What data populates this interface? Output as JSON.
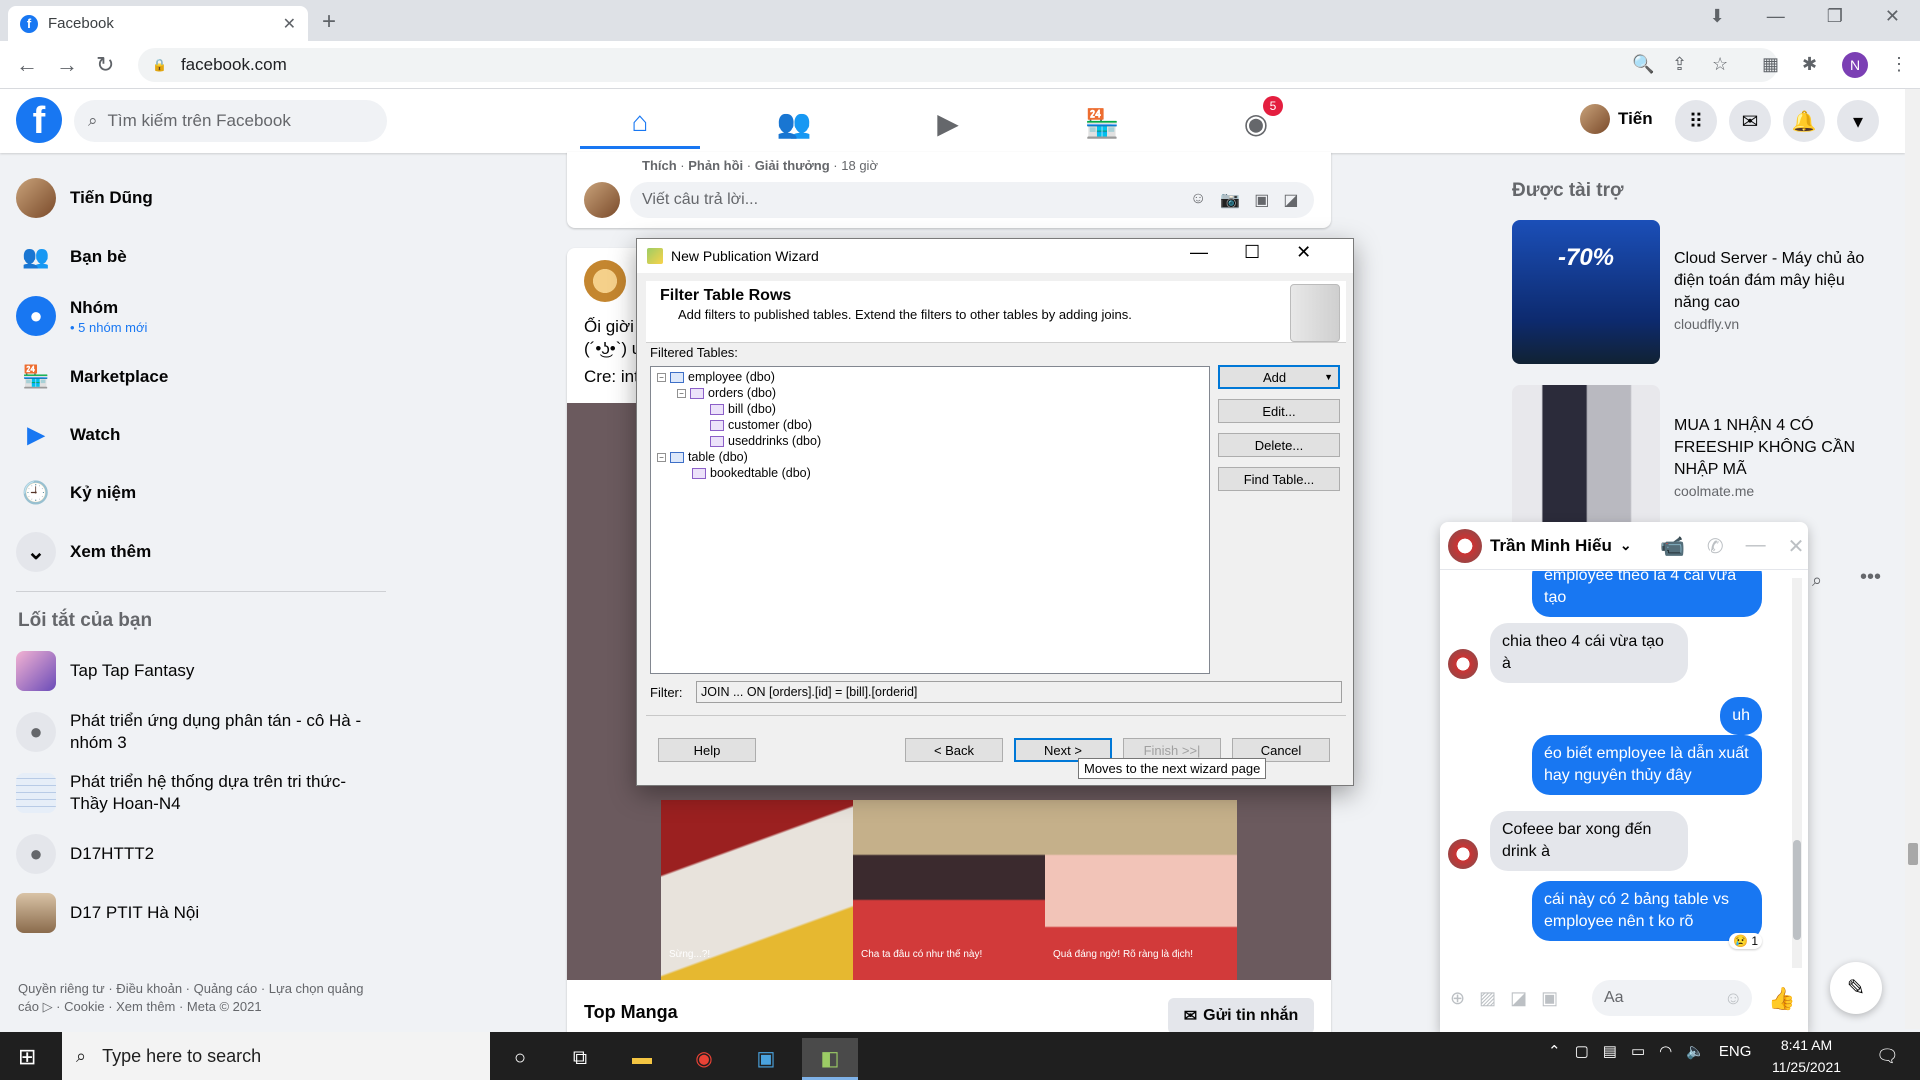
{
  "browser": {
    "tab_title": "Facebook",
    "tab_close": "✕",
    "new_tab": "+",
    "url": "facebook.com",
    "profile_initial": "N"
  },
  "fb": {
    "search_placeholder": "Tìm kiếm trên Facebook",
    "notification_count": "5",
    "user_name": "Tiến"
  },
  "sidebar": {
    "items": [
      {
        "label": "Tiến Dũng"
      },
      {
        "label": "Bạn bè"
      },
      {
        "label": "Nhóm",
        "sub": "5 nhóm mới"
      },
      {
        "label": "Marketplace"
      },
      {
        "label": "Watch"
      },
      {
        "label": "Kỷ niệm"
      },
      {
        "label": "Xem thêm"
      }
    ],
    "shortcuts_title": "Lối tắt của bạn",
    "shortcuts": [
      {
        "label": "Tap Tap Fantasy"
      },
      {
        "label": "Phát triển ứng dụng phân tán - cô Hà - nhóm 3"
      },
      {
        "label": "Phát triển hệ thống dựa trên tri thức- Thầy Hoan-N4"
      },
      {
        "label": "D17HTTT2"
      },
      {
        "label": "D17 PTIT Hà Nội"
      }
    ],
    "footer": "Quyền riêng tư · Điều khoản · Quảng cáo · Lựa chọn quảng cáo ▷ · Cookie · Xem thêm · Meta © 2021"
  },
  "feed": {
    "comment_like": "Thích",
    "comment_reply": "Phản hồi",
    "comment_award": "Giải thưởng",
    "comment_time": "18 giờ",
    "reply_placeholder": "Viết câu trả lời...",
    "post_text_1": "Ối giời",
    "post_text_2": "(´•͜ʖ•`) u",
    "post_text_3": "Cre: int",
    "captions": [
      "Sừng...?!",
      "Cha ta đâu có như thế này!",
      "Quá đáng ngờ! Rõ ràng là địch!"
    ],
    "post_title": "Top Manga",
    "send_message": "Gửi tin nhắn"
  },
  "right": {
    "sponsored": "Được tài trợ",
    "ads": [
      {
        "title": "Cloud Server - Máy chủ ảo điện toán đám mây hiệu năng cao",
        "url": "cloudfly.vn",
        "banner": "-70%"
      },
      {
        "title": "MUA 1 NHẬN 4 CÓ FREESHIP KHÔNG CẦN NHẬP MÃ",
        "url": "coolmate.me"
      }
    ]
  },
  "chat": {
    "name": "Trần Minh Hiếu",
    "messages": [
      {
        "dir": "out",
        "text": "employee theo lá 4 cái vừa tạo"
      },
      {
        "dir": "in",
        "text": "chia theo 4 cái vừa tạo à"
      },
      {
        "dir": "out",
        "text": "uh"
      },
      {
        "dir": "out",
        "text": "éo biết employee là dẫn xuất hay nguyên thủy đây"
      },
      {
        "dir": "in",
        "text": "Cofeee bar xong đến drink à"
      },
      {
        "dir": "out",
        "text": "cái này có 2 bảng table vs employee nên t ko rõ"
      }
    ],
    "reaction": "😢 1",
    "input_placeholder": "Aa"
  },
  "dialog": {
    "window_title": "New Publication Wizard",
    "header_title": "Filter Table Rows",
    "header_desc": "Add filters to published tables. Extend the filters to other tables by adding joins.",
    "filtered_tables_label": "Filtered Tables:",
    "tree": [
      {
        "label": "employee (dbo)",
        "level": 0,
        "toggle": "−"
      },
      {
        "label": "orders (dbo)",
        "level": 1,
        "toggle": "−"
      },
      {
        "label": "bill (dbo)",
        "level": 2
      },
      {
        "label": "customer (dbo)",
        "level": 2
      },
      {
        "label": "useddrinks (dbo)",
        "level": 2
      },
      {
        "label": "table (dbo)",
        "level": 0,
        "toggle": "−"
      },
      {
        "label": "bookedtable (dbo)",
        "level": 1
      }
    ],
    "buttons": {
      "add": "Add",
      "edit": "Edit...",
      "delete": "Delete...",
      "find": "Find Table...",
      "help": "Help",
      "back": "< Back",
      "next": "Next >",
      "finish": "Finish >>|",
      "cancel": "Cancel"
    },
    "filter_label": "Filter:",
    "filter_value": "JOIN ... ON [orders].[id] = [bill].[orderid]",
    "tooltip": "Moves to the next wizard page"
  },
  "taskbar": {
    "search_placeholder": "Type here to search",
    "language": "ENG",
    "time": "8:41 AM",
    "date": "11/25/2021"
  }
}
